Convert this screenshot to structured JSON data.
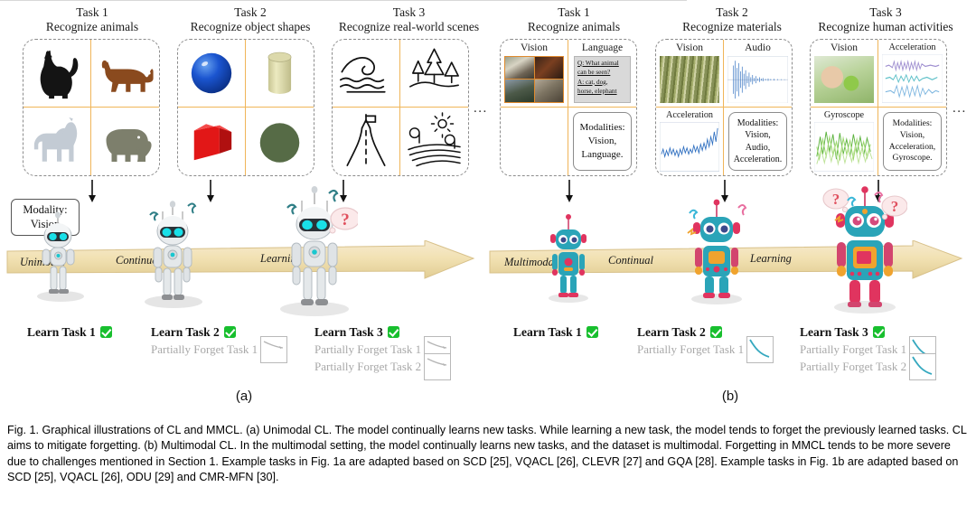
{
  "figure": {
    "panel_a_label": "(a)",
    "panel_b_label": "(b)",
    "ellipsis": "..."
  },
  "panel_a": {
    "tasks": [
      {
        "number": "Task 1",
        "description": "Recognize animals",
        "items": [
          "cat",
          "dog",
          "horse",
          "elephant"
        ]
      },
      {
        "number": "Task 2",
        "description": "Recognize object shapes",
        "items": [
          "blue sphere",
          "beige cylinder",
          "red cube",
          "green circle"
        ]
      },
      {
        "number": "Task 3",
        "description": "Recognize real-world scenes",
        "items": [
          "ocean wave",
          "forest",
          "road junction",
          "farmland with sun"
        ]
      }
    ],
    "callout": {
      "line1": "Modality:",
      "line2": "Vision"
    },
    "timeline": {
      "word1": "Unimodal",
      "word2": "Continual",
      "word3": "Learning"
    },
    "learn_groups": [
      {
        "main": "Learn Task 1",
        "forgets": []
      },
      {
        "main": "Learn Task 2",
        "forgets": [
          "Partially Forget Task 1"
        ]
      },
      {
        "main": "Learn Task 3",
        "forgets": [
          "Partially Forget Task 1",
          "Partially Forget Task 2"
        ]
      }
    ]
  },
  "panel_b": {
    "tasks": [
      {
        "number": "Task 1",
        "description": "Recognize animals",
        "modalities": [
          "Vision",
          "Language"
        ],
        "summary": [
          "Modalities:",
          "Vision,",
          "Language."
        ],
        "qa": [
          "Q: What animal",
          "can be seen?",
          "A: cat, dog,",
          "horse, elephant"
        ]
      },
      {
        "number": "Task 2",
        "description": "Recognize materials",
        "modalities": [
          "Vision",
          "Audio",
          "Acceleration"
        ],
        "summary": [
          "Modalities:",
          "Vision,",
          "Audio,",
          "Acceleration."
        ]
      },
      {
        "number": "Task 3",
        "description": "Recognize human activities",
        "modalities": [
          "Vision",
          "Acceleration",
          "Gyroscope"
        ],
        "summary": [
          "Modalities:",
          "Vision,",
          "Acceleration,",
          "Gyroscope."
        ]
      }
    ],
    "timeline": {
      "word1": "Multimodal",
      "word2": "Continual",
      "word3": "Learning"
    },
    "learn_groups": [
      {
        "main": "Learn Task 1",
        "forgets": []
      },
      {
        "main": "Learn Task 2",
        "forgets": [
          "Partially Forget Task 1"
        ]
      },
      {
        "main": "Learn Task 3",
        "forgets": [
          "Partially Forget Task 1",
          "Partially Forget Task 2"
        ]
      }
    ]
  },
  "caption": {
    "text": "Fig. 1. Graphical illustrations of CL and MMCL. (a) Unimodal CL. The model continually learns new tasks. While learning a new task, the model tends to forget the previously learned tasks. CL aims to mitigate forgetting. (b) Multimodal CL. In the multimodal setting, the model continually learns new tasks, and the dataset is multimodal. Forgetting in MMCL tends to be more severe due to challenges mentioned in Section 1. Example tasks in Fig. 1a are adapted based on SCD [25], VQACL [26], CLEVR [27] and GQA [28]. Example tasks in Fig. 1b are adapted based on SCD [25], VQACL [26], ODU [29] and CMR-MFN [30]."
  },
  "colors": {
    "accent_orange": "#f0b559",
    "banner": "#f2e3b8",
    "check_green": "#18bf2e",
    "forget_gray": "#a8a8a8",
    "curve_teal": "#35a8bf",
    "dashed_border": "#8c8c8c"
  }
}
